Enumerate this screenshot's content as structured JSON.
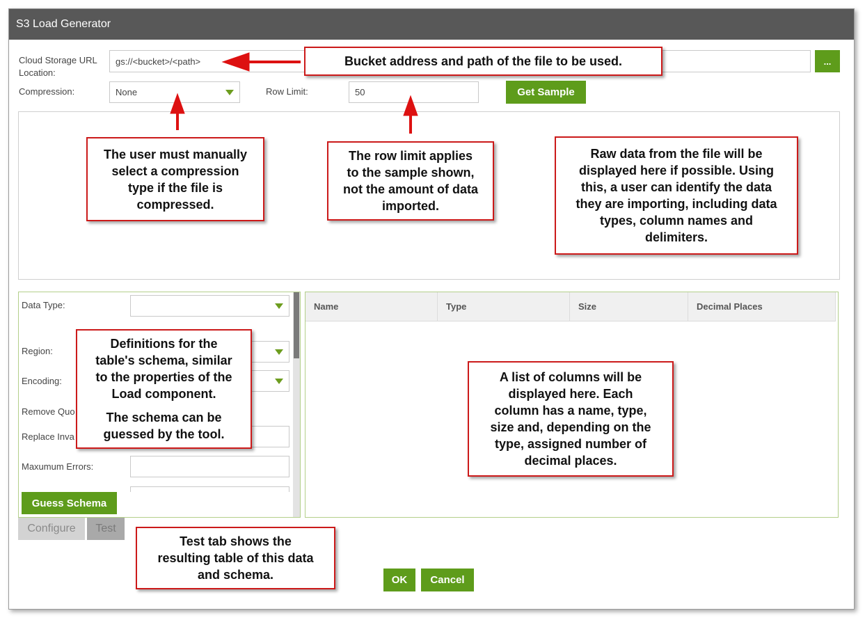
{
  "window": {
    "title": "S3 Load Generator"
  },
  "form": {
    "url_label": "Cloud Storage URL Location:",
    "url_value": "gs://<bucket>/<path>",
    "browse_label": "...",
    "compression_label": "Compression:",
    "compression_value": "None",
    "row_limit_label": "Row Limit:",
    "row_limit_value": "50",
    "get_sample_label": "Get Sample"
  },
  "properties": {
    "data_type_label": "Data Type:",
    "data_type_value": "",
    "region_label": "Region:",
    "encoding_label": "Encoding:",
    "remove_quotes_label": "Remove Quo",
    "replace_invalid_label": "Replace Inva",
    "max_errors_label": "Maxumum Errors:",
    "guess_schema_label": "Guess Schema"
  },
  "columns_table": {
    "headers": [
      "Name",
      "Type",
      "Size",
      "Decimal Places"
    ]
  },
  "tabs": [
    {
      "label": "Configure"
    },
    {
      "label": "Test"
    }
  ],
  "footer": {
    "ok_label": "OK",
    "cancel_label": "Cancel"
  },
  "callouts": {
    "bucket": "Bucket address and path of the file to be used.",
    "compression": [
      "The user must manually",
      "select a compression",
      "type if the file is",
      "compressed."
    ],
    "row_limit": [
      "The row limit applies",
      "to the sample shown,",
      "not the amount of data",
      "imported."
    ],
    "raw_data": [
      "Raw data from the file will be",
      "displayed here if possible. Using",
      "this, a user can identify the data",
      "they are importing, including data",
      "types, column names and",
      "delimiters."
    ],
    "schema": [
      "Definitions for the",
      "table's schema, similar",
      "to the properties of the",
      "Load component."
    ],
    "schema_guess": [
      "The schema can be",
      "guessed by the tool."
    ],
    "columns": [
      "A list of columns will be",
      "displayed here. Each",
      "column has a name, type,",
      "size and, depending on the",
      "type, assigned number of",
      "decimal places."
    ],
    "test_tab": [
      "Test tab shows the",
      "resulting table of this data",
      "and schema."
    ]
  },
  "colors": {
    "titlebar": "#585858",
    "accent_green": "#5e9c1b",
    "callout_red": "#cc1a1a"
  }
}
